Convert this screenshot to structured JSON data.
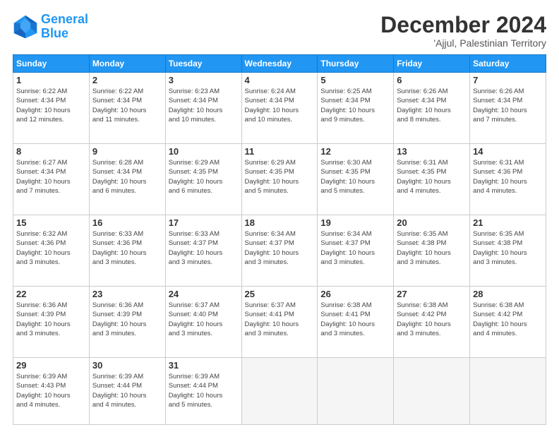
{
  "logo": {
    "line1": "General",
    "line2": "Blue"
  },
  "title": "December 2024",
  "subtitle": "'Ajjul, Palestinian Territory",
  "headers": [
    "Sunday",
    "Monday",
    "Tuesday",
    "Wednesday",
    "Thursday",
    "Friday",
    "Saturday"
  ],
  "weeks": [
    [
      {
        "day": "1",
        "info": "Sunrise: 6:22 AM\nSunset: 4:34 PM\nDaylight: 10 hours\nand 12 minutes."
      },
      {
        "day": "2",
        "info": "Sunrise: 6:22 AM\nSunset: 4:34 PM\nDaylight: 10 hours\nand 11 minutes."
      },
      {
        "day": "3",
        "info": "Sunrise: 6:23 AM\nSunset: 4:34 PM\nDaylight: 10 hours\nand 10 minutes."
      },
      {
        "day": "4",
        "info": "Sunrise: 6:24 AM\nSunset: 4:34 PM\nDaylight: 10 hours\nand 10 minutes."
      },
      {
        "day": "5",
        "info": "Sunrise: 6:25 AM\nSunset: 4:34 PM\nDaylight: 10 hours\nand 9 minutes."
      },
      {
        "day": "6",
        "info": "Sunrise: 6:26 AM\nSunset: 4:34 PM\nDaylight: 10 hours\nand 8 minutes."
      },
      {
        "day": "7",
        "info": "Sunrise: 6:26 AM\nSunset: 4:34 PM\nDaylight: 10 hours\nand 7 minutes."
      }
    ],
    [
      {
        "day": "8",
        "info": "Sunrise: 6:27 AM\nSunset: 4:34 PM\nDaylight: 10 hours\nand 7 minutes."
      },
      {
        "day": "9",
        "info": "Sunrise: 6:28 AM\nSunset: 4:34 PM\nDaylight: 10 hours\nand 6 minutes."
      },
      {
        "day": "10",
        "info": "Sunrise: 6:29 AM\nSunset: 4:35 PM\nDaylight: 10 hours\nand 6 minutes."
      },
      {
        "day": "11",
        "info": "Sunrise: 6:29 AM\nSunset: 4:35 PM\nDaylight: 10 hours\nand 5 minutes."
      },
      {
        "day": "12",
        "info": "Sunrise: 6:30 AM\nSunset: 4:35 PM\nDaylight: 10 hours\nand 5 minutes."
      },
      {
        "day": "13",
        "info": "Sunrise: 6:31 AM\nSunset: 4:35 PM\nDaylight: 10 hours\nand 4 minutes."
      },
      {
        "day": "14",
        "info": "Sunrise: 6:31 AM\nSunset: 4:36 PM\nDaylight: 10 hours\nand 4 minutes."
      }
    ],
    [
      {
        "day": "15",
        "info": "Sunrise: 6:32 AM\nSunset: 4:36 PM\nDaylight: 10 hours\nand 3 minutes."
      },
      {
        "day": "16",
        "info": "Sunrise: 6:33 AM\nSunset: 4:36 PM\nDaylight: 10 hours\nand 3 minutes."
      },
      {
        "day": "17",
        "info": "Sunrise: 6:33 AM\nSunset: 4:37 PM\nDaylight: 10 hours\nand 3 minutes."
      },
      {
        "day": "18",
        "info": "Sunrise: 6:34 AM\nSunset: 4:37 PM\nDaylight: 10 hours\nand 3 minutes."
      },
      {
        "day": "19",
        "info": "Sunrise: 6:34 AM\nSunset: 4:37 PM\nDaylight: 10 hours\nand 3 minutes."
      },
      {
        "day": "20",
        "info": "Sunrise: 6:35 AM\nSunset: 4:38 PM\nDaylight: 10 hours\nand 3 minutes."
      },
      {
        "day": "21",
        "info": "Sunrise: 6:35 AM\nSunset: 4:38 PM\nDaylight: 10 hours\nand 3 minutes."
      }
    ],
    [
      {
        "day": "22",
        "info": "Sunrise: 6:36 AM\nSunset: 4:39 PM\nDaylight: 10 hours\nand 3 minutes."
      },
      {
        "day": "23",
        "info": "Sunrise: 6:36 AM\nSunset: 4:39 PM\nDaylight: 10 hours\nand 3 minutes."
      },
      {
        "day": "24",
        "info": "Sunrise: 6:37 AM\nSunset: 4:40 PM\nDaylight: 10 hours\nand 3 minutes."
      },
      {
        "day": "25",
        "info": "Sunrise: 6:37 AM\nSunset: 4:41 PM\nDaylight: 10 hours\nand 3 minutes."
      },
      {
        "day": "26",
        "info": "Sunrise: 6:38 AM\nSunset: 4:41 PM\nDaylight: 10 hours\nand 3 minutes."
      },
      {
        "day": "27",
        "info": "Sunrise: 6:38 AM\nSunset: 4:42 PM\nDaylight: 10 hours\nand 3 minutes."
      },
      {
        "day": "28",
        "info": "Sunrise: 6:38 AM\nSunset: 4:42 PM\nDaylight: 10 hours\nand 4 minutes."
      }
    ],
    [
      {
        "day": "29",
        "info": "Sunrise: 6:39 AM\nSunset: 4:43 PM\nDaylight: 10 hours\nand 4 minutes."
      },
      {
        "day": "30",
        "info": "Sunrise: 6:39 AM\nSunset: 4:44 PM\nDaylight: 10 hours\nand 4 minutes."
      },
      {
        "day": "31",
        "info": "Sunrise: 6:39 AM\nSunset: 4:44 PM\nDaylight: 10 hours\nand 5 minutes."
      },
      {
        "day": "",
        "info": ""
      },
      {
        "day": "",
        "info": ""
      },
      {
        "day": "",
        "info": ""
      },
      {
        "day": "",
        "info": ""
      }
    ]
  ]
}
